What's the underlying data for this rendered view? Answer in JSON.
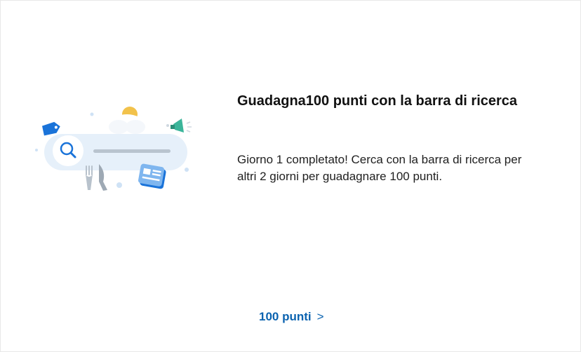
{
  "card": {
    "title": "Guadagna100 punti con la barra di ricerca",
    "description": "Giorno 1 completato! Cerca con la barra di ricerca per altri 2 giorni per guadagnare 100 punti.",
    "points_link": "100 punti",
    "points_chevron": ">"
  },
  "illustration": {
    "icons": [
      "tag-icon",
      "search-icon",
      "cloud-sun-icon",
      "megaphone-icon",
      "fork-knife-icon",
      "news-icon"
    ]
  },
  "colors": {
    "accent": "#0b63b0",
    "search_bar": "#e3eef8",
    "tag": "#1a73d9",
    "sun": "#f2c24b",
    "megaphone": "#3bb59a"
  }
}
